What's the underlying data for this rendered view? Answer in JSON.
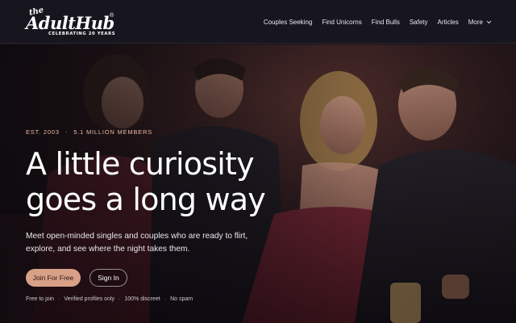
{
  "logo": {
    "small": "the",
    "word": "AdultHub",
    "registered": "®",
    "tagline": "CELEBRATING 20 YEARS"
  },
  "nav": {
    "items": [
      "Couples Seeking",
      "Find Unicorns",
      "Find Bulls",
      "Safety",
      "Articles"
    ],
    "more_label": "More"
  },
  "hero": {
    "eyebrow_left": "EST. 2003",
    "eyebrow_sep": "·",
    "eyebrow_right": "5.1 MILLION MEMBERS",
    "headline": "A little curiosity goes a long way",
    "subhead": "Meet open-minded singles and couples who are ready to flirt, explore, and see where the night takes them.",
    "join_label": "Join For Free",
    "signin_label": "Sign In",
    "perks": [
      "Free to join",
      "Verified profiles only",
      "100% discreet",
      "No spam"
    ],
    "perk_sep": "·"
  },
  "colors": {
    "header_bg": "#17151e",
    "accent": "#d9a088",
    "eyebrow": "#e8b8a4"
  },
  "icons": {
    "more": "chevron-down-icon"
  }
}
